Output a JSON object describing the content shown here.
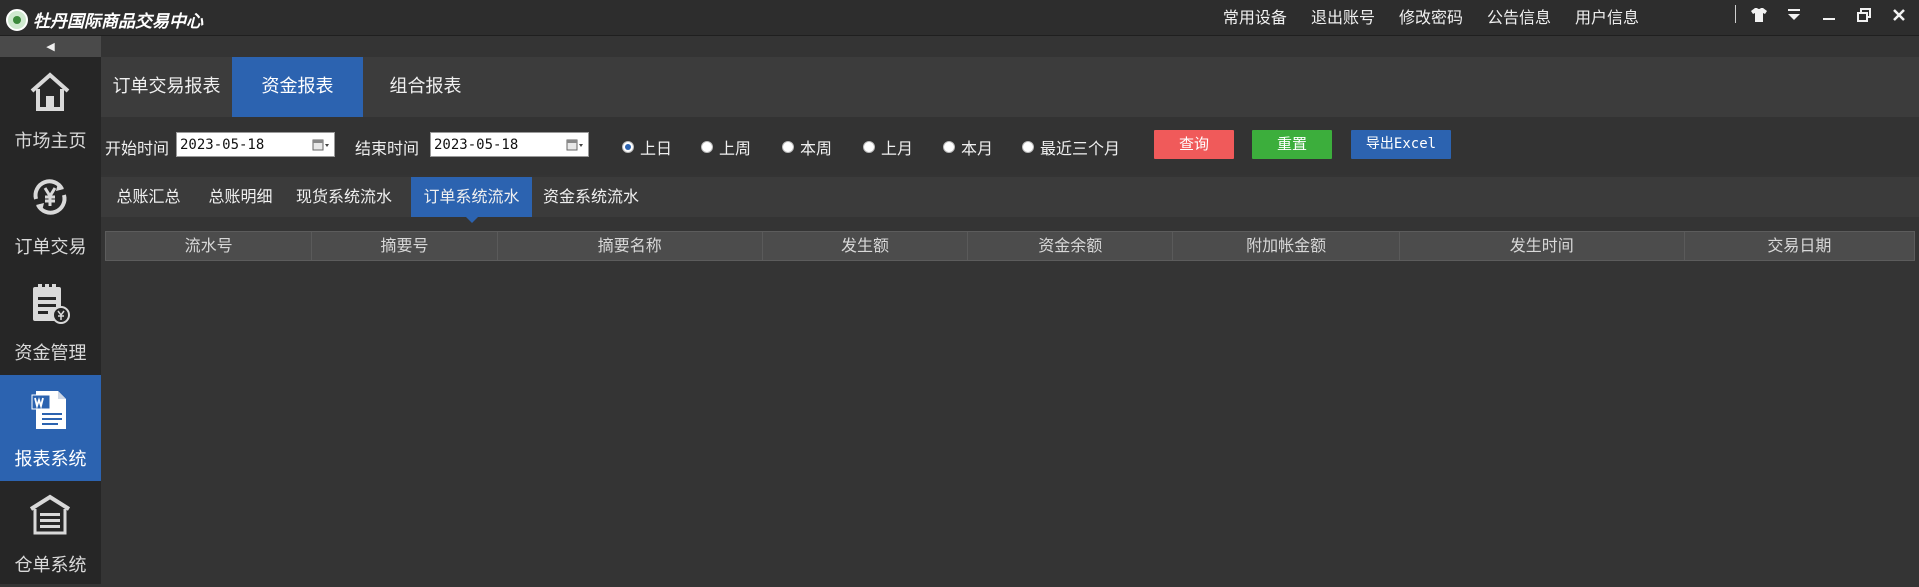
{
  "app": {
    "title": "牡丹国际商品交易中心"
  },
  "top_menu": [
    "常用设备",
    "退出账号",
    "修改密码",
    "公告信息",
    "用户信息"
  ],
  "window_icons": [
    "shirt-icon",
    "dropdown-icon",
    "minimize-icon",
    "restore-icon",
    "close-icon"
  ],
  "sidebar": {
    "collapse_glyph": "◀",
    "items": [
      {
        "label": "市场主页",
        "icon": "home-icon"
      },
      {
        "label": "订单交易",
        "icon": "yen-refresh-icon"
      },
      {
        "label": "资金管理",
        "icon": "clipboard-yen-icon"
      },
      {
        "label": "报表系统",
        "icon": "word-document-icon",
        "active": true
      },
      {
        "label": "仓单系统",
        "icon": "warehouse-icon"
      }
    ]
  },
  "tabs": [
    {
      "label": "订单交易报表"
    },
    {
      "label": "资金报表",
      "active": true
    },
    {
      "label": "组合报表"
    }
  ],
  "filter": {
    "start_label": "开始时间",
    "start_value": "2023-05-18",
    "end_label": "结束时间",
    "end_value": "2023-05-18",
    "ranges": [
      {
        "label": "上日",
        "checked": true
      },
      {
        "label": "上周"
      },
      {
        "label": "本周"
      },
      {
        "label": "上月"
      },
      {
        "label": "本月"
      },
      {
        "label": "最近三个月"
      }
    ],
    "query_label": "查询",
    "reset_label": "重置",
    "export_label": "导出Excel"
  },
  "subtabs": [
    {
      "label": "总账汇总"
    },
    {
      "label": "总账明细"
    },
    {
      "label": "现货系统流水"
    },
    {
      "label": "订单系统流水",
      "active": true
    },
    {
      "label": "资金系统流水"
    }
  ],
  "table": {
    "columns": [
      "流水号",
      "摘要号",
      "摘要名称",
      "发生额",
      "资金余额",
      "附加帐金额",
      "发生时间",
      "交易日期"
    ],
    "rows": []
  },
  "colors": {
    "accent": "#2c63b0",
    "query": "#f05a5a",
    "reset": "#3cae3c",
    "export": "#2c63b0",
    "background": "#343434"
  }
}
